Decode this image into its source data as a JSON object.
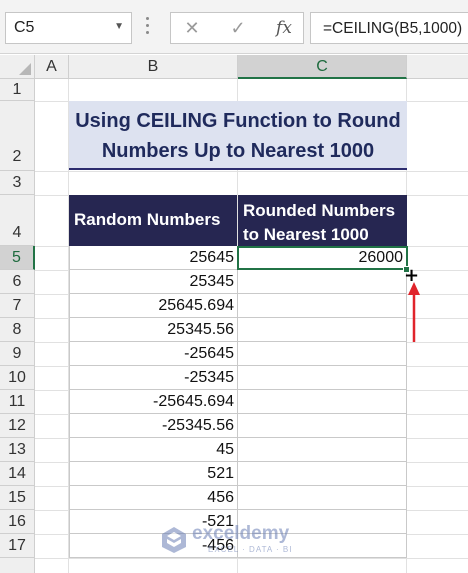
{
  "formula_bar": {
    "name_box": "C5",
    "cancel_icon": "✕",
    "enter_icon": "✓",
    "fx_label": "fx",
    "formula": "=CEILING(B5,1000)"
  },
  "columns": [
    "A",
    "B",
    "C"
  ],
  "selected_column": "C",
  "rows": [
    "1",
    "2",
    "3",
    "4",
    "5",
    "6",
    "7",
    "8",
    "9",
    "10",
    "11",
    "12",
    "13",
    "14",
    "15",
    "16",
    "17"
  ],
  "selected_row": "5",
  "sheet": {
    "title_line1": "Using CEILING Function to Round",
    "title_line2": "Numbers Up to Nearest 1000",
    "header_b": "Random Numbers",
    "header_c_line1": "Rounded Numbers",
    "header_c_line2": "to Nearest 1000",
    "values_b": [
      "25645",
      "25345",
      "25645.694",
      "25345.56",
      "-25645",
      "-25345",
      "-25645.694",
      "-25345.56",
      "45",
      "521",
      "456",
      "-521",
      "-456"
    ],
    "values_c": [
      "26000",
      "",
      "",
      "",
      "",
      "",
      "",
      "",
      "",
      "",
      "",
      "",
      ""
    ]
  },
  "watermark": {
    "name": "exceldemy",
    "tagline": "EXCEL · DATA · BI"
  },
  "colors": {
    "excel_green": "#217346",
    "header_navy": "#262651",
    "title_fill": "#dde2f0",
    "arrow_red": "#e0242b"
  },
  "icons": [
    "chevron-down-icon",
    "close-icon",
    "check-icon",
    "function-icon",
    "fill-cursor-icon",
    "up-arrow-icon",
    "exceldemy-logo-icon"
  ]
}
